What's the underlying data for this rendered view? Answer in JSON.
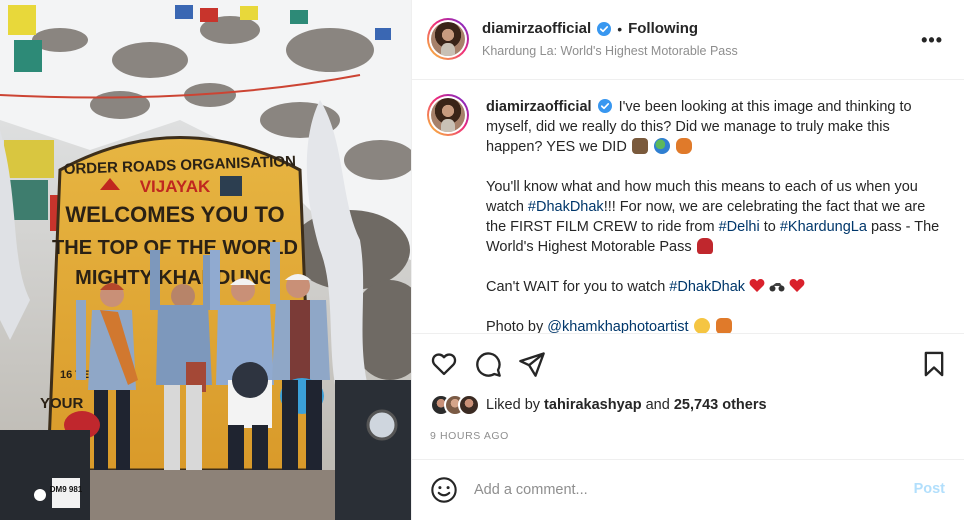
{
  "post": {
    "username": "diamirzaofficial",
    "follow_status": "Following",
    "separator": "•",
    "location": "Khardung La: World's Highest Motorable Pass",
    "more_label": "•••"
  },
  "photo": {
    "sign_lines": [
      "ORDER ROADS ORGANISATION",
      "VIJAYAK",
      "WELCOMES YOU TO",
      "THE TOP OF THE WORLD",
      "MIGHTY KHARDUNG",
      "16 TE",
      "YOUR"
    ],
    "bike_plate": "DM9 981"
  },
  "caption": {
    "username": "diamirzaofficial",
    "p1": "I've been looking at this image and thinking to myself, did we really do this? Did we manage to truly make this happen? YES we DID",
    "p2_a": "You'll know what and how much this means to each of us when you watch",
    "p2_tag1": "#DhakDhak",
    "p2_b": "!!! For now, we are celebrating the fact that we are the FIRST FILM CREW to ride from",
    "p2_tag2": "#Delhi",
    "p2_c": "to",
    "p2_tag3": "#KhardungLa",
    "p2_d": "pass - The World's Highest Motorable Pass",
    "p3_a": "Can't WAIT for you to watch",
    "p3_tag": "#DhakDhak",
    "p4_a": "Photo by",
    "p4_tag": "@khamkhaphotoartist"
  },
  "engagement": {
    "liked_by_prefix": "Liked by",
    "liked_by_user": "tahirakashyap",
    "liked_by_and": "and",
    "others_count": "25,743 others",
    "timestamp": "9 HOURS AGO"
  },
  "comment_box": {
    "placeholder": "Add a comment...",
    "post_label": "Post"
  },
  "colors": {
    "link": "#00376b",
    "verified": "#3897f0",
    "post_disabled": "#b2dffc",
    "muted": "#8e8e8e"
  },
  "icons": [
    "verified-badge-icon",
    "more-options-icon",
    "heart-icon",
    "comment-icon",
    "share-icon",
    "bookmark-icon",
    "emoji-icon"
  ]
}
